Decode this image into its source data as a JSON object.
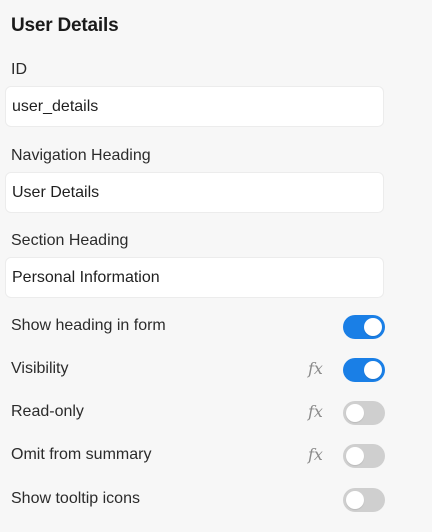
{
  "panel": {
    "title": "User Details"
  },
  "fields": [
    {
      "label": "ID",
      "value": "user_details"
    },
    {
      "label": "Navigation Heading",
      "value": "User Details"
    },
    {
      "label": "Section Heading",
      "value": "Personal Information"
    }
  ],
  "toggles": [
    {
      "label": "Show heading in form",
      "on": true,
      "has_formula": false
    },
    {
      "label": "Visibility",
      "on": true,
      "has_formula": true
    },
    {
      "label": "Read-only",
      "on": false,
      "has_formula": true
    },
    {
      "label": "Omit from summary",
      "on": false,
      "has_formula": true
    },
    {
      "label": "Show tooltip icons",
      "on": false,
      "has_formula": false
    }
  ],
  "icons": {
    "formula": "fx-icon"
  },
  "colors": {
    "toggle_on": "#1a7fe6",
    "toggle_off": "#cfcfcf",
    "background": "#f7f7f7"
  }
}
